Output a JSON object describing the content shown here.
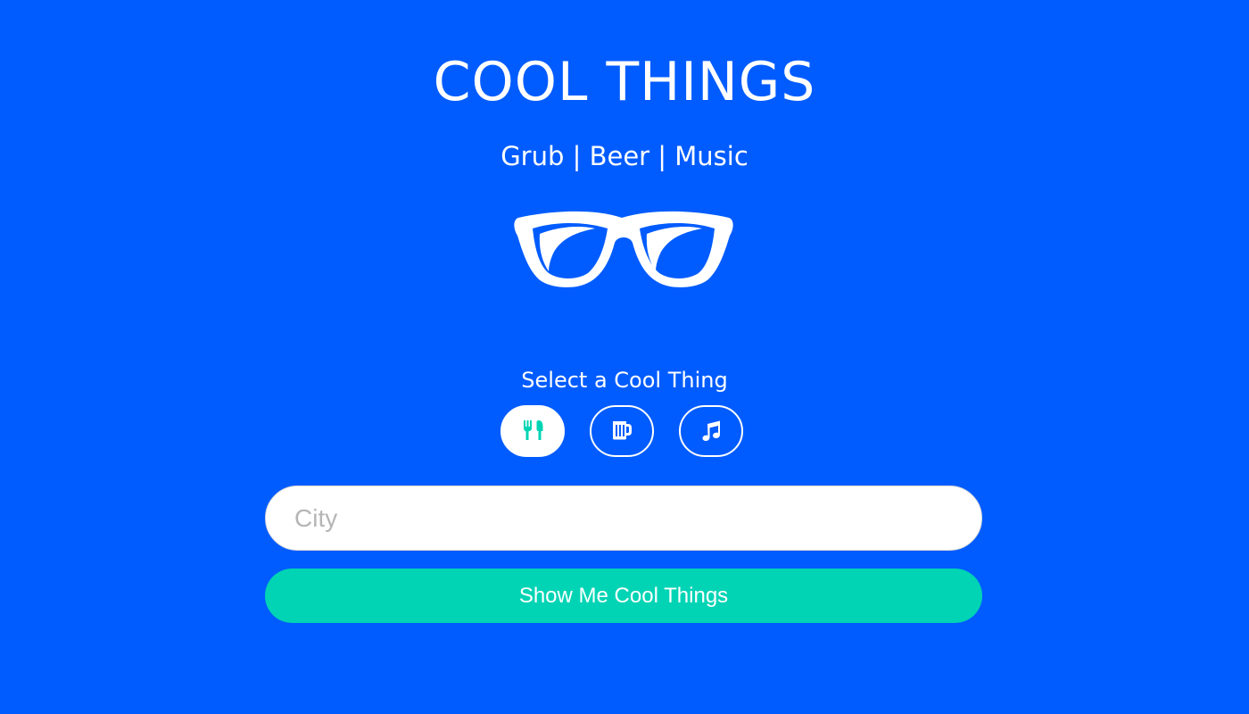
{
  "header": {
    "title": "COOL THINGS",
    "subtitle": "Grub | Beer | Music"
  },
  "logo": {
    "icon": "glasses-icon"
  },
  "selector": {
    "label": "Select a Cool Thing",
    "options": [
      {
        "name": "Grub",
        "icon": "utensils-icon",
        "selected": true
      },
      {
        "name": "Beer",
        "icon": "beer-mug-icon",
        "selected": false
      },
      {
        "name": "Music",
        "icon": "music-note-icon",
        "selected": false
      }
    ]
  },
  "search": {
    "placeholder": "City",
    "value": ""
  },
  "submit": {
    "label": "Show Me Cool Things"
  },
  "colors": {
    "background": "#005CFF",
    "accent": "#00D4B4",
    "text": "#FFFFFF"
  }
}
